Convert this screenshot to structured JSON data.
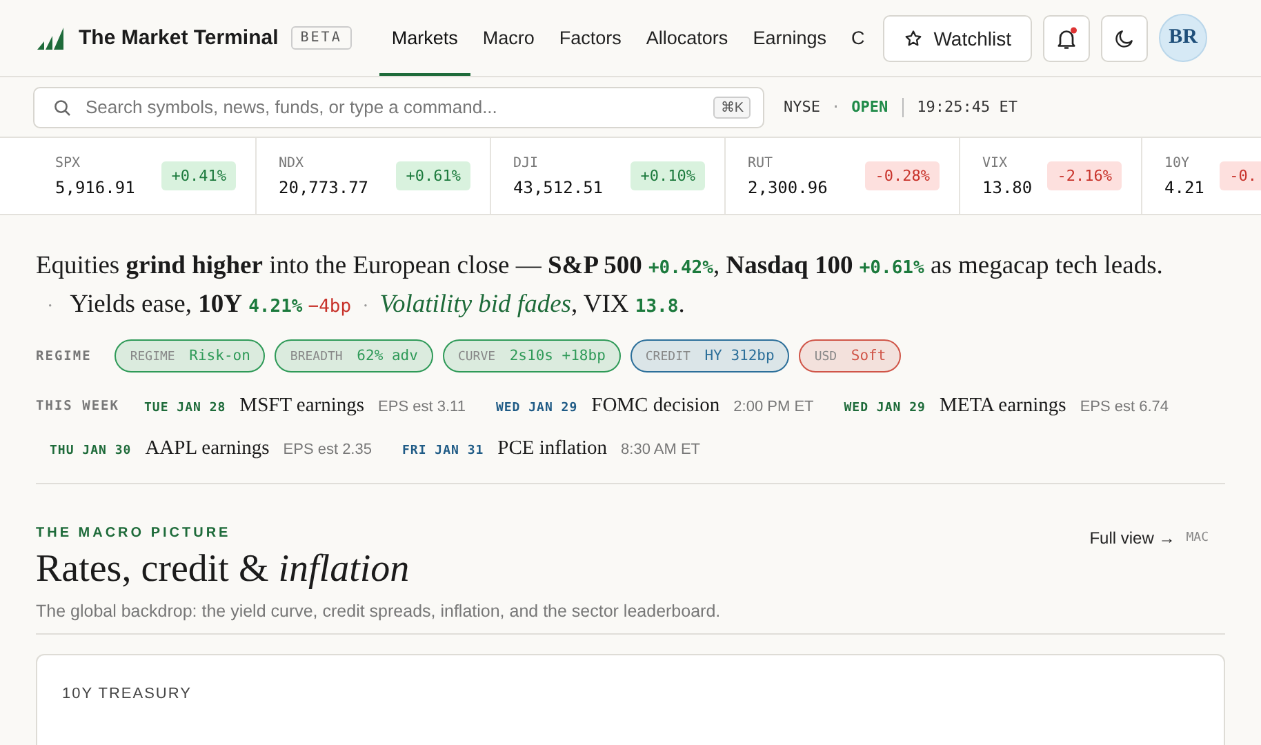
{
  "brand": {
    "name": "The Market Terminal",
    "badge": "BETA"
  },
  "nav": [
    {
      "label": "Markets",
      "selected": true
    },
    {
      "label": "Macro",
      "selected": false
    },
    {
      "label": "Factors",
      "selected": false
    },
    {
      "label": "Allocators",
      "selected": false
    },
    {
      "label": "Earnings",
      "selected": false
    },
    {
      "label": "C",
      "selected": false
    }
  ],
  "watchlist": "Watchlist",
  "notifications": {
    "unread": true
  },
  "avatar": "BR",
  "search": {
    "placeholder": "Search symbols, news, funds, or type a command...",
    "shortcut": "⌘K"
  },
  "market": {
    "exchange": "NYSE",
    "sep": "·",
    "status": "OPEN",
    "open": true,
    "time": "19:25:45 ET"
  },
  "tickers": [
    {
      "symbol": "SPX",
      "price": "5,916.91",
      "change": "+0.41%",
      "up": true
    },
    {
      "symbol": "NDX",
      "price": "20,773.77",
      "change": "+0.61%",
      "up": true
    },
    {
      "symbol": "DJI",
      "price": "43,512.51",
      "change": "+0.10%",
      "up": true
    },
    {
      "symbol": "RUT",
      "price": "2,300.96",
      "change": "-0.28%",
      "up": false
    },
    {
      "symbol": "VIX",
      "price": "13.80",
      "change": "-2.16%",
      "up": false
    },
    {
      "symbol": "10Y",
      "price": "4.21",
      "change": "-0.",
      "up": false
    }
  ],
  "headline": [
    {
      "kind": "text",
      "text": "Equities **grind higher** into the European close — **S&P 500** "
    },
    {
      "kind": "up",
      "text": "+0.42%"
    },
    {
      "kind": "text",
      "text": ", **Nasdaq 100** "
    },
    {
      "kind": "up",
      "text": "+0.61%"
    },
    {
      "kind": "text",
      "text": " as megacap tech leads. "
    },
    {
      "kind": "sep",
      "text": "·"
    },
    {
      "kind": "text",
      "text": " Yields ease, **10Y** "
    },
    {
      "kind": "up",
      "text": "4.21%"
    },
    {
      "kind": "down",
      "text": "−4bp"
    },
    {
      "kind": "sep",
      "text": "·"
    },
    {
      "kind": "em",
      "text": "Volatility bid fades"
    },
    {
      "kind": "text",
      "text": ", VIX "
    },
    {
      "kind": "up",
      "text": "13.8"
    },
    {
      "kind": "text",
      "text": "."
    }
  ],
  "regime": {
    "label": "REGIME",
    "chips": [
      {
        "key": "REGIME",
        "value": "Risk-on",
        "color": "#2f9a58"
      },
      {
        "key": "BREADTH",
        "value": "62% adv",
        "color": "#2f9a58"
      },
      {
        "key": "CURVE",
        "value": "2s10s +18bp",
        "color": "#2f9a58"
      },
      {
        "key": "CREDIT",
        "value": "HY 312bp",
        "color": "#2c6f9a"
      },
      {
        "key": "USD",
        "value": "Soft",
        "color": "#d05548"
      }
    ]
  },
  "week": {
    "label": "THIS WEEK",
    "events": [
      {
        "date": "TUE JAN 28",
        "title": "MSFT earnings",
        "detail": "EPS est 3.11",
        "kind": "earnings"
      },
      {
        "date": "WED JAN 29",
        "title": "FOMC decision",
        "detail": "2:00 PM ET",
        "kind": "macro"
      },
      {
        "date": "WED JAN 29",
        "title": "META earnings",
        "detail": "EPS est 6.74",
        "kind": "earnings"
      },
      {
        "date": "THU JAN 30",
        "title": "AAPL earnings",
        "detail": "EPS est 2.35",
        "kind": "earnings"
      },
      {
        "date": "FRI JAN 31",
        "title": "PCE inflation",
        "detail": "8:30 AM ET",
        "kind": "macro"
      }
    ]
  },
  "section": {
    "eyebrow": "THE MACRO PICTURE",
    "title": "Rates, credit & *inflation*",
    "subtitle": "The global backdrop: the yield curve, credit spreads, inflation, and the sector leaderboard.",
    "link": "Full view →",
    "shortcut": "MAC"
  },
  "card": {
    "title": "10Y TREASURY"
  }
}
